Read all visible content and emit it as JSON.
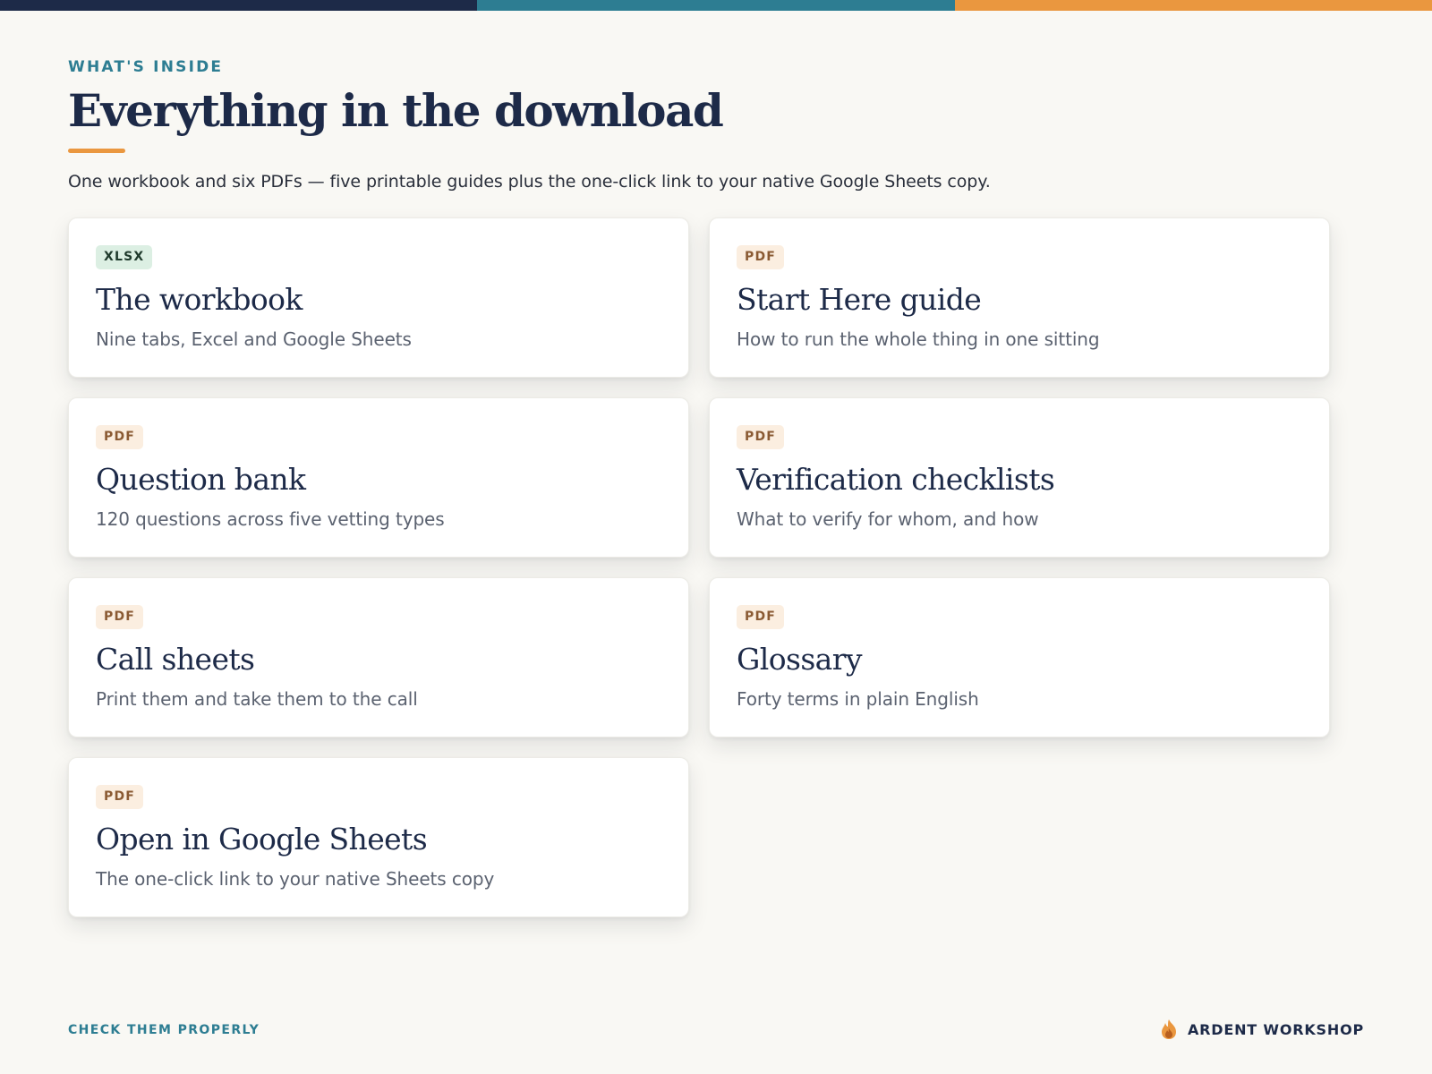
{
  "colors": {
    "navy": "#1d2a48",
    "teal": "#2d7d92",
    "orange": "#ea973f",
    "background": "#f9f8f4"
  },
  "top_stripe": [
    "#1d2a48",
    "#2d7d92",
    "#ea973f"
  ],
  "header": {
    "eyebrow": "WHAT'S INSIDE",
    "title": "Everything in the download",
    "lead": "One workbook and six PDFs — five printable guides plus the one-click link to your native Google Sheets copy."
  },
  "items": [
    {
      "badge": "XLSX",
      "title": "The workbook",
      "description": "Nine tabs, Excel and Google Sheets"
    },
    {
      "badge": "PDF",
      "title": "Start Here guide",
      "description": "How to run the whole thing in one sitting"
    },
    {
      "badge": "PDF",
      "title": "Question bank",
      "description": "120 questions across five vetting types"
    },
    {
      "badge": "PDF",
      "title": "Verification checklists",
      "description": "What to verify for whom, and how"
    },
    {
      "badge": "PDF",
      "title": "Call sheets",
      "description": "Print them and take them to the call"
    },
    {
      "badge": "PDF",
      "title": "Glossary",
      "description": "Forty terms in plain English"
    },
    {
      "badge": "PDF",
      "title": "Open in Google Sheets",
      "description": "The one-click link to your native Sheets copy"
    }
  ],
  "footer": {
    "tagline": "CHECK THEM PROPERLY",
    "brand": "ARDENT WORKSHOP",
    "brand_icon": "flame-icon"
  }
}
